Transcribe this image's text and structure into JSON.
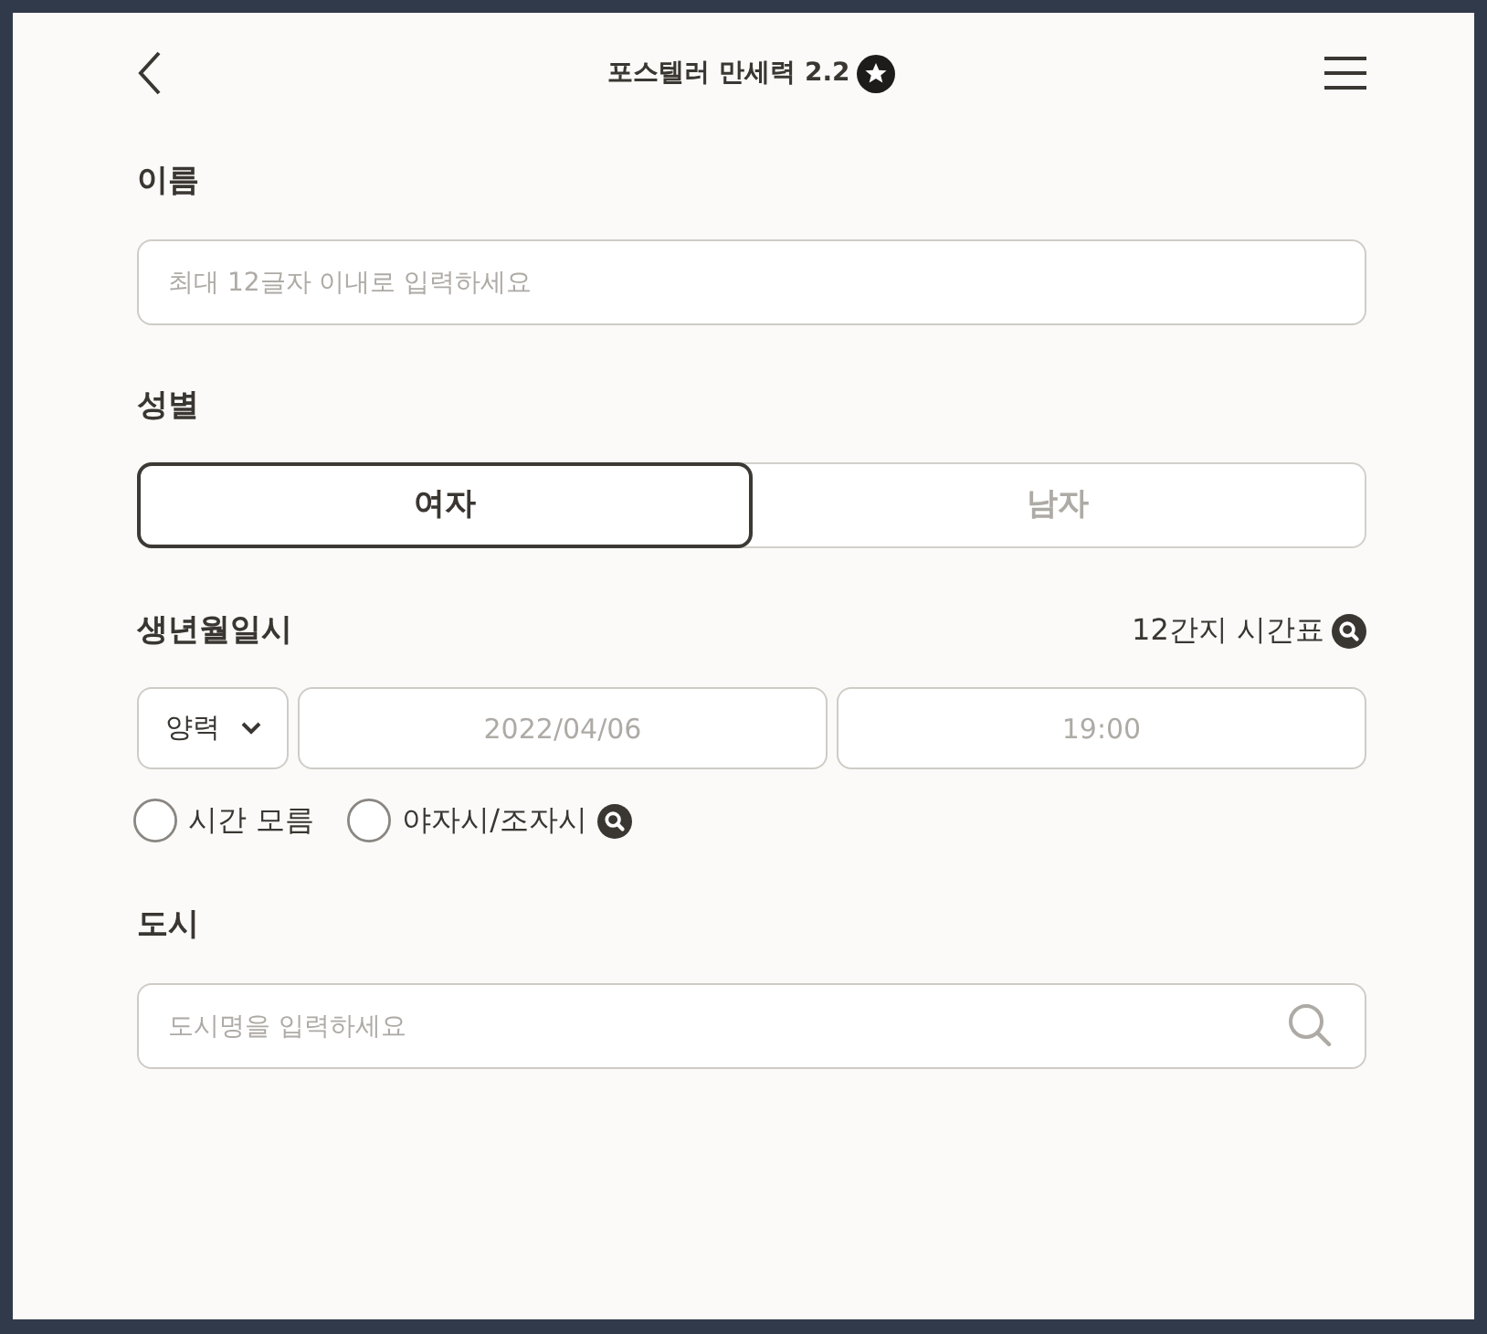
{
  "header": {
    "title": "포스텔러 만세력 2.2"
  },
  "name_field": {
    "label": "이름",
    "placeholder": "최대 12글자 이내로 입력하세요"
  },
  "gender": {
    "label": "성별",
    "options": [
      {
        "label": "여자",
        "selected": true
      },
      {
        "label": "남자",
        "selected": false
      }
    ]
  },
  "birth": {
    "label": "생년월일시",
    "link": "12간지 시간표",
    "calendar": {
      "value": "양력"
    },
    "date": {
      "placeholder": "2022/04/06"
    },
    "time": {
      "placeholder": "19:00"
    },
    "options": [
      {
        "label": "시간 모름",
        "checked": false,
        "info": false
      },
      {
        "label": "야자시/조자시",
        "checked": false,
        "info": true
      }
    ]
  },
  "city": {
    "label": "도시",
    "placeholder": "도시명을 입력하세요"
  }
}
